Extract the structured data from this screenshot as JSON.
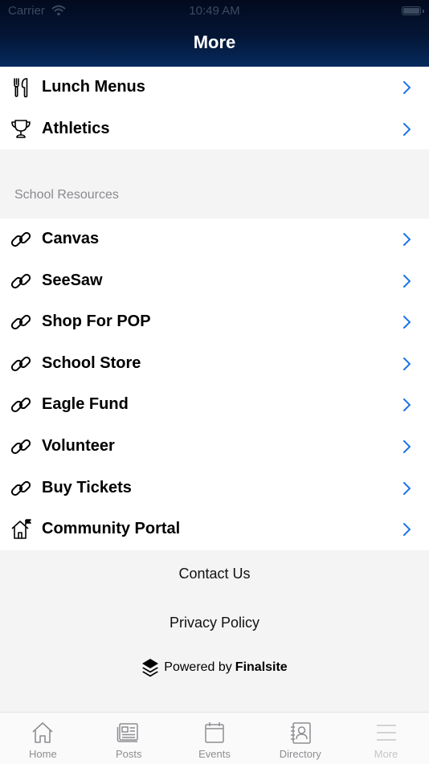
{
  "status_bar": {
    "carrier": "Carrier",
    "time": "10:49 AM"
  },
  "header": {
    "title": "More"
  },
  "top_items": [
    {
      "label": "Lunch Menus",
      "icon": "utensils-icon"
    },
    {
      "label": "Athletics",
      "icon": "trophy-icon"
    }
  ],
  "section": {
    "label": "School Resources"
  },
  "resource_items": [
    {
      "label": "Canvas",
      "icon": "link-icon"
    },
    {
      "label": "SeeSaw",
      "icon": "link-icon"
    },
    {
      "label": "Shop For POP",
      "icon": "link-icon"
    },
    {
      "label": "School Store",
      "icon": "link-icon"
    },
    {
      "label": "Eagle Fund",
      "icon": "link-icon"
    },
    {
      "label": "Volunteer",
      "icon": "link-icon"
    },
    {
      "label": "Buy Tickets",
      "icon": "link-icon"
    },
    {
      "label": "Community Portal",
      "icon": "house-flag-icon"
    }
  ],
  "footer": {
    "contact": "Contact Us",
    "privacy": "Privacy Policy",
    "powered_prefix": "Powered by",
    "powered_brand": "Finalsite"
  },
  "tabs": [
    {
      "label": "Home",
      "icon": "home-icon"
    },
    {
      "label": "Posts",
      "icon": "newspaper-icon"
    },
    {
      "label": "Events",
      "icon": "calendar-icon"
    },
    {
      "label": "Directory",
      "icon": "contact-card-icon"
    },
    {
      "label": "More",
      "icon": "hamburger-menu-icon",
      "active": true
    }
  ],
  "colors": {
    "accent": "#1a73e8",
    "header": "#041636",
    "inactive_tab": "#8e8e93"
  }
}
